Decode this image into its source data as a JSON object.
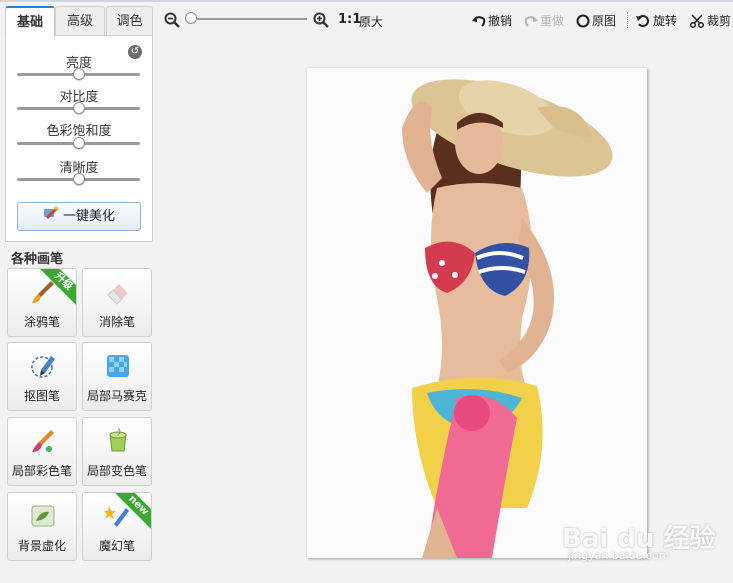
{
  "tabs": [
    {
      "label": "基础",
      "active": true
    },
    {
      "label": "高级",
      "active": false
    },
    {
      "label": "调色",
      "active": false
    }
  ],
  "basic_panel": {
    "reset_icon": "reset-icon",
    "sliders": [
      {
        "label": "亮度",
        "value": 0.5
      },
      {
        "label": "对比度",
        "value": 0.5
      },
      {
        "label": "色彩饱和度",
        "value": 0.5
      },
      {
        "label": "清晰度",
        "value": 0.5
      }
    ],
    "beautify_label": "一键美化"
  },
  "brushes": {
    "title": "各种画笔",
    "items": [
      {
        "label": "涂鸦笔",
        "icon": "paintbrush-icon",
        "badge": "升级"
      },
      {
        "label": "消除笔",
        "icon": "eraser-icon",
        "badge": ""
      },
      {
        "label": "抠图笔",
        "icon": "cutout-pen-icon",
        "badge": ""
      },
      {
        "label": "局部马赛克",
        "icon": "mosaic-icon",
        "badge": ""
      },
      {
        "label": "局部彩色笔",
        "icon": "color-brush-icon",
        "badge": ""
      },
      {
        "label": "局部变色笔",
        "icon": "paint-bucket-icon",
        "badge": ""
      },
      {
        "label": "背景虚化",
        "icon": "blur-background-icon",
        "badge": ""
      },
      {
        "label": "魔幻笔",
        "icon": "magic-pen-icon",
        "badge": "new"
      }
    ]
  },
  "toolbar": {
    "zoom_value": 0.0,
    "ratio_label": "1:1",
    "original_size_label": "原大",
    "undo_label": "撤销",
    "redo_label": "重做",
    "original_label": "原图",
    "rotate_label": "旋转",
    "crop_label": "裁剪"
  },
  "watermark": {
    "brand": "Bai du 经验",
    "url": "jingyan.baidu.com"
  },
  "colors": {
    "accent": "#2f7fd1",
    "badge_green": "#3aa833",
    "button_border": "#8fb3d9"
  }
}
